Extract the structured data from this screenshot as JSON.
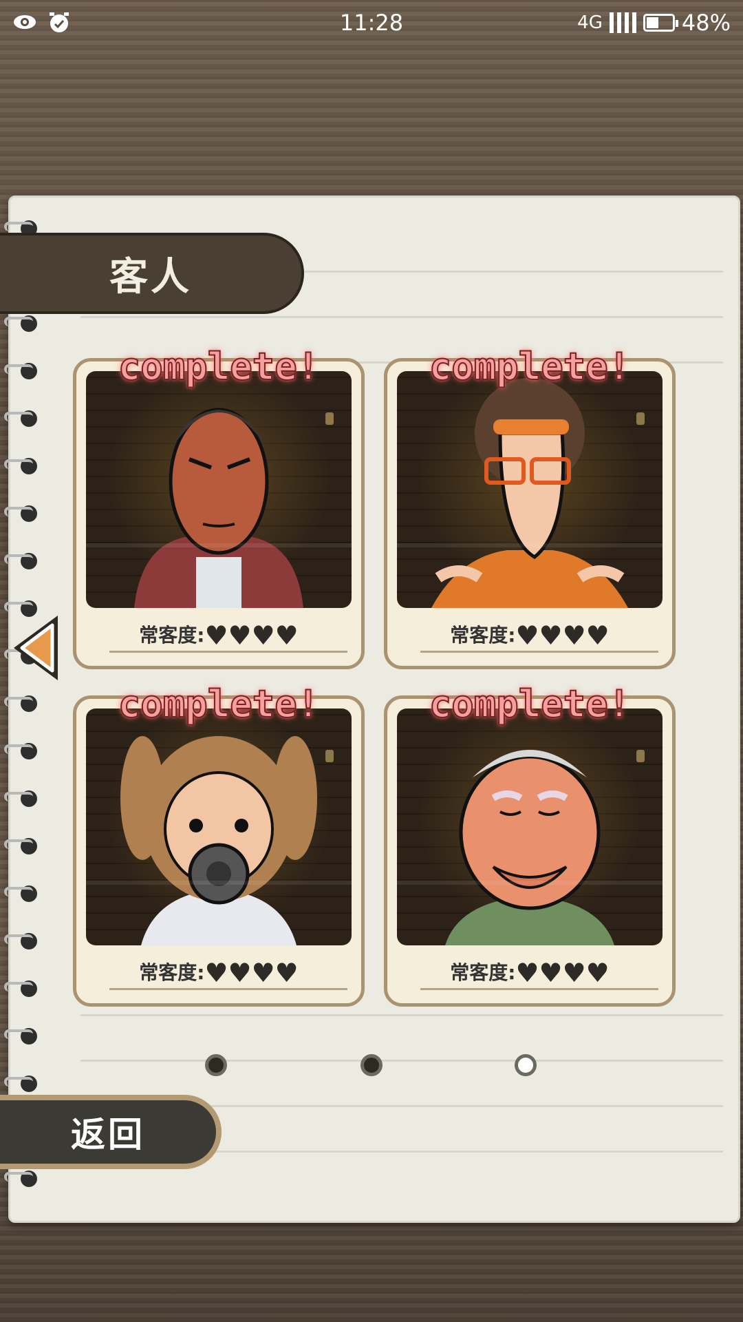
{
  "status_bar": {
    "time": "11:28",
    "network": "4G",
    "battery": "48%",
    "battery_level": 0.48,
    "left_icons": [
      "eye-icon",
      "alarm-clock-icon"
    ]
  },
  "header": {
    "title": "客人"
  },
  "cards": [
    {
      "badge": "complete!",
      "regular_label": "常客度:",
      "hearts": 4,
      "character": "middle-aged man in red jacket"
    },
    {
      "badge": "complete!",
      "regular_label": "常客度:",
      "hearts": 4,
      "character": "curly-haired man with orange glasses"
    },
    {
      "badge": "complete!",
      "regular_label": "常客度:",
      "hearts": 4,
      "character": "twin-tail girl in gas mask"
    },
    {
      "badge": "complete!",
      "regular_label": "常客度:",
      "hearts": 4,
      "character": "elderly man in green kimono"
    }
  ],
  "pagination": {
    "pages": 3,
    "current": 3
  },
  "back_button": {
    "label": "返回"
  },
  "colors": {
    "accent_arrow": "#e89a4c",
    "badge_text": "#f3a0a0",
    "card_border": "#a99370"
  }
}
